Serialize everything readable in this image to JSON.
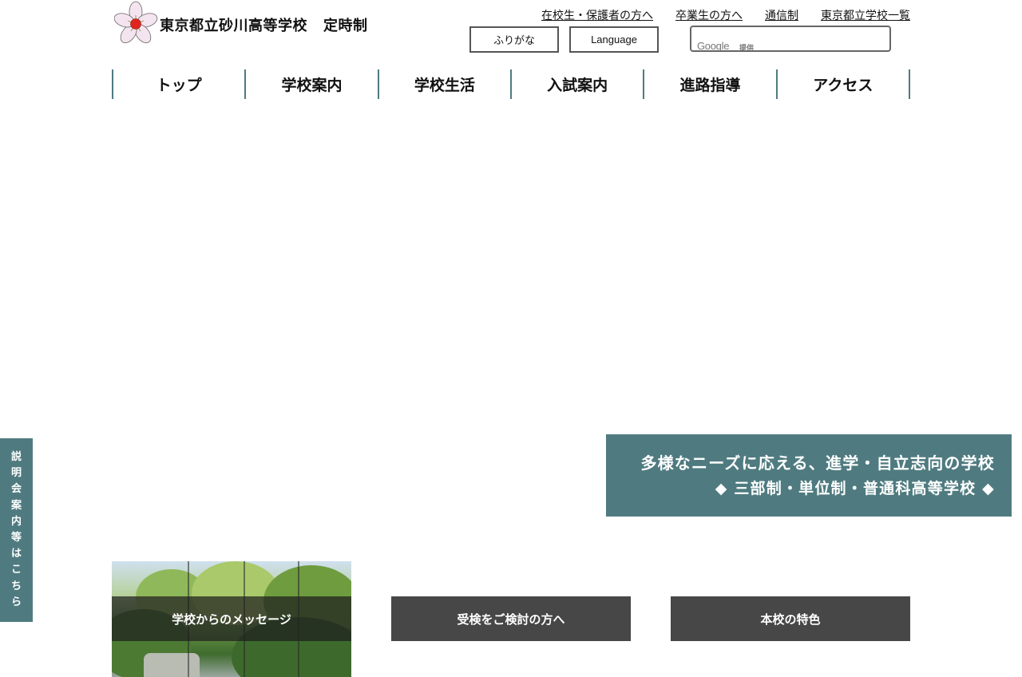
{
  "header": {
    "school_name": "東京都立砂川高等学校",
    "school_course": "定時制",
    "logo_icon": "cherry-blossom-emblem-icon"
  },
  "util_links": [
    {
      "label": "在校生・保護者の方へ"
    },
    {
      "label": "卒業生の方へ"
    },
    {
      "label": "通信制"
    },
    {
      "label": "東京都立学校一覧"
    }
  ],
  "tools": {
    "furigana_label": "ふりがな",
    "language_label": "Language",
    "search_brand": "Google",
    "search_note": "提供"
  },
  "global_nav": [
    {
      "label": "トップ"
    },
    {
      "label": "学校案内"
    },
    {
      "label": "学校生活"
    },
    {
      "label": "入試案内"
    },
    {
      "label": "進路指導"
    },
    {
      "label": "アクセス"
    }
  ],
  "tagline": {
    "line1": "多様なニーズに応える、進学・自立志向の学校",
    "line2": "◆ 三部制・単位制・普通科高等学校 ◆"
  },
  "side_tab": {
    "chars": [
      "説",
      "明",
      "会",
      "案",
      "内",
      "等",
      "は",
      "こ",
      "ち",
      "ら"
    ]
  },
  "cards": {
    "message_label": "学校からのメッセージ",
    "exam_label": "受検をご検討の方へ",
    "feature_label": "本校の特色"
  },
  "colors": {
    "accent_teal": "#4f7b80",
    "card_dark": "#474747"
  }
}
